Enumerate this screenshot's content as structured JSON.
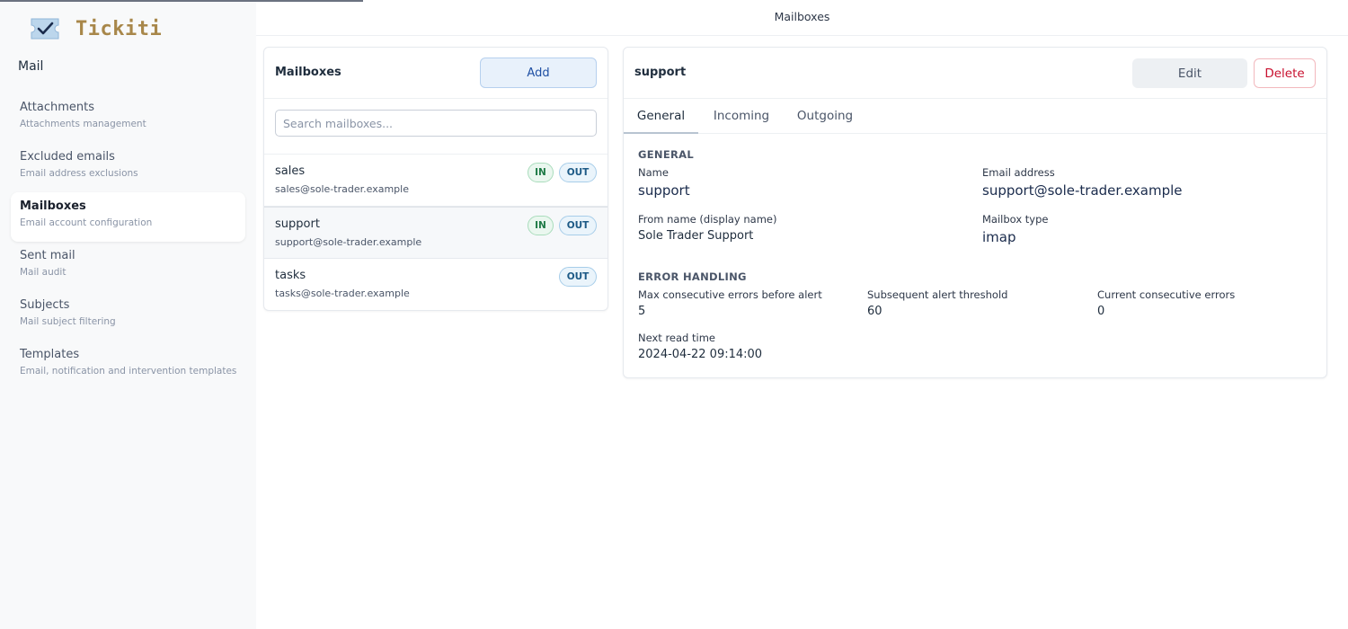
{
  "app": {
    "name": "Tickiti"
  },
  "sidebar": {
    "section": "Mail",
    "items": [
      {
        "label": "Attachments",
        "sub": "Attachments management",
        "active": false
      },
      {
        "label": "Excluded emails",
        "sub": "Email address exclusions",
        "active": false
      },
      {
        "label": "Mailboxes",
        "sub": "Email account configuration",
        "active": true
      },
      {
        "label": "Sent mail",
        "sub": "Mail audit",
        "active": false
      },
      {
        "label": "Subjects",
        "sub": "Mail subject filtering",
        "active": false
      },
      {
        "label": "Templates",
        "sub": "Email, notification and intervention templates",
        "active": false
      }
    ]
  },
  "header": {
    "title": "Mailboxes"
  },
  "list": {
    "title": "Mailboxes",
    "add_label": "Add",
    "search_placeholder": "Search mailboxes...",
    "rows": [
      {
        "name": "sales",
        "email": "sales@sole-trader.example",
        "in": "IN",
        "out": "OUT"
      },
      {
        "name": "support",
        "email": "support@sole-trader.example",
        "in": "IN",
        "out": "OUT"
      },
      {
        "name": "tasks",
        "email": "tasks@sole-trader.example",
        "out": "OUT"
      }
    ]
  },
  "detail": {
    "title": "support",
    "edit_label": "Edit",
    "delete_label": "Delete",
    "tabs": [
      "General",
      "Incoming",
      "Outgoing"
    ],
    "general": {
      "heading": "GENERAL",
      "name_label": "Name",
      "name_value": "support",
      "email_label": "Email address",
      "email_value": "support@sole-trader.example",
      "from_label": "From name (display name)",
      "from_value": "Sole Trader Support",
      "type_label": "Mailbox type",
      "type_value": "imap"
    },
    "errors": {
      "heading": "ERROR HANDLING",
      "max_label": "Max consecutive errors before alert",
      "max_value": "5",
      "threshold_label": "Subsequent alert threshold",
      "threshold_value": "60",
      "current_label": "Current consecutive errors",
      "current_value": "0",
      "next_label": "Next read time",
      "next_value": "2024-04-22 09:14:00"
    }
  },
  "colors": {
    "accent": "#1e4fa3",
    "danger": "#c8102e",
    "logo": "#a8874a"
  }
}
